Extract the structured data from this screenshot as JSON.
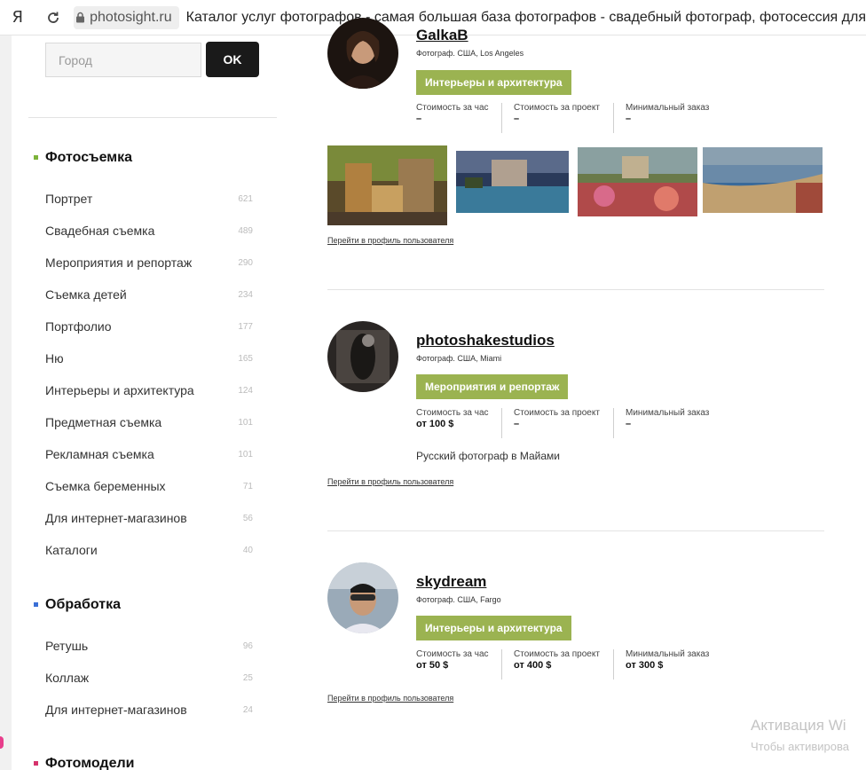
{
  "browser": {
    "logo": "Я",
    "domain": "photosight.ru",
    "title": "Каталог услуг фотографов - самая большая база фотографов - свадебный фотограф, фотосессия для"
  },
  "sidebar": {
    "city_placeholder": "Город",
    "ok_label": "OK",
    "photo_section": {
      "title": "Фотосъемка",
      "bullet_color": "#7db33a",
      "items": [
        {
          "label": "Портрет",
          "count": "621"
        },
        {
          "label": "Свадебная съемка",
          "count": "489"
        },
        {
          "label": "Мероприятия и репортаж",
          "count": "290"
        },
        {
          "label": "Съемка детей",
          "count": "234"
        },
        {
          "label": "Портфолио",
          "count": "177"
        },
        {
          "label": "Ню",
          "count": "165"
        },
        {
          "label": "Интерьеры и архитектура",
          "count": "124"
        },
        {
          "label": "Предметная съемка",
          "count": "101"
        },
        {
          "label": "Рекламная съемка",
          "count": "101"
        },
        {
          "label": "Съемка беременных",
          "count": "71"
        },
        {
          "label": "Для интернет-магазинов",
          "count": "56"
        },
        {
          "label": "Каталоги",
          "count": "40"
        }
      ]
    },
    "processing_section": {
      "title": "Обработка",
      "bullet_color": "#3a6fd6",
      "items": [
        {
          "label": "Ретушь",
          "count": "96"
        },
        {
          "label": "Коллаж",
          "count": "25"
        },
        {
          "label": "Для интернет-магазинов",
          "count": "24"
        }
      ]
    },
    "models_section": {
      "title": "Фотомодели",
      "bullet_color": "#d6336c"
    }
  },
  "cards": [
    {
      "name": "GalkaB",
      "location": "Фотограф. США, Los Angeles",
      "tag": "Интерьеры и архитектура",
      "prices": [
        {
          "label": "Стоимость за час",
          "value": "–"
        },
        {
          "label": "Стоимость за проект",
          "value": "–"
        },
        {
          "label": "Минимальный заказ",
          "value": "–"
        }
      ],
      "profile_link": "Перейти в профиль пользователя"
    },
    {
      "name": "photoshakestudios",
      "location": "Фотограф. США, Miami",
      "tag": "Мероприятия и репортаж",
      "prices": [
        {
          "label": "Стоимость за час",
          "value": "от 100 $"
        },
        {
          "label": "Стоимость за проект",
          "value": "–"
        },
        {
          "label": "Минимальный заказ",
          "value": "–"
        }
      ],
      "description": "Русский фотограф в Майами",
      "profile_link": "Перейти в профиль пользователя"
    },
    {
      "name": "skydream",
      "location": "Фотограф. США, Fargo",
      "tag": "Интерьеры и архитектура",
      "prices": [
        {
          "label": "Стоимость за час",
          "value": "от 50 $"
        },
        {
          "label": "Стоимость за проект",
          "value": "от 400 $"
        },
        {
          "label": "Минимальный заказ",
          "value": "от 300 $"
        }
      ],
      "profile_link": "Перейти в профиль пользователя"
    }
  ],
  "watermark": {
    "line1": "Активация Wi",
    "line2": "Чтобы активирова"
  },
  "colors": {
    "tag_green": "#9bb351",
    "ok_button": "#1a1a1a"
  }
}
